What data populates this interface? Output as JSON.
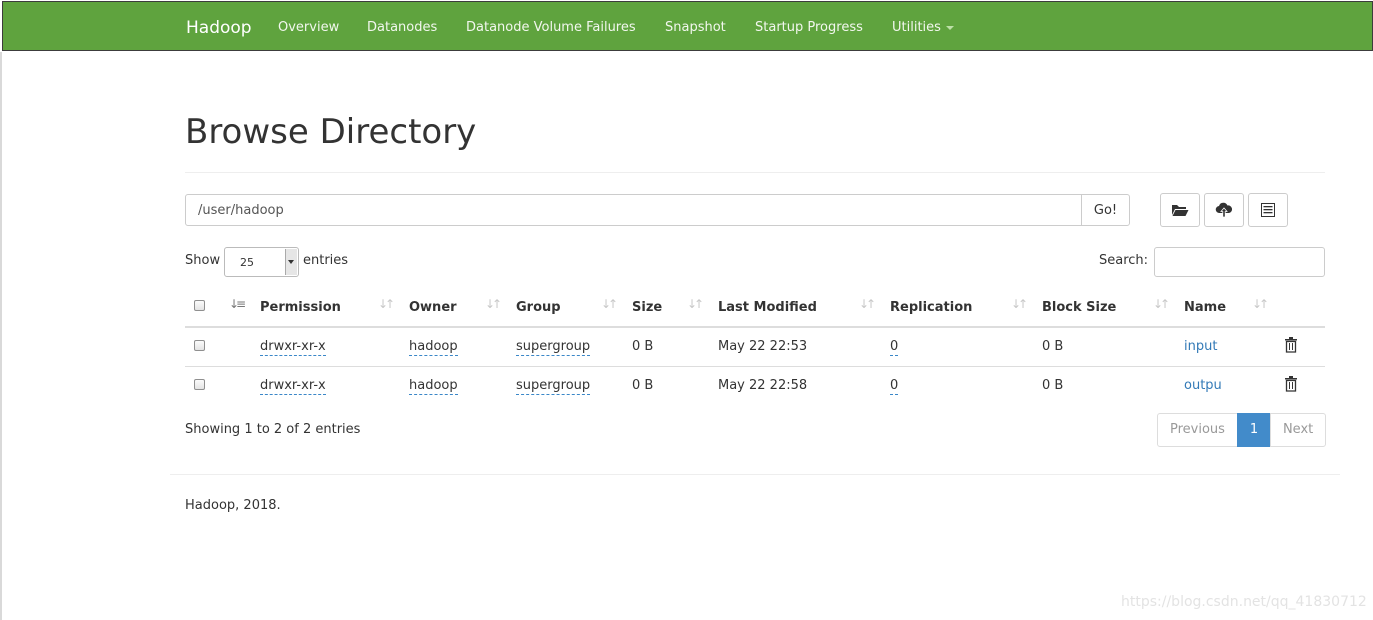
{
  "navbar": {
    "brand": "Hadoop",
    "items": [
      "Overview",
      "Datanodes",
      "Datanode Volume Failures",
      "Snapshot",
      "Startup Progress",
      "Utilities"
    ]
  },
  "page": {
    "title": "Browse Directory"
  },
  "path_bar": {
    "value": "/user/hadoop",
    "go_label": "Go!"
  },
  "toolbar": {
    "icons": [
      "folder-open-icon",
      "cloud-upload-icon",
      "list-icon"
    ]
  },
  "table_controls": {
    "show_label": "Show",
    "entries_value": "25",
    "entries_label": "entries",
    "search_label": "Search:"
  },
  "table": {
    "columns": [
      "Permission",
      "Owner",
      "Group",
      "Size",
      "Last Modified",
      "Replication",
      "Block Size",
      "Name"
    ],
    "rows": [
      {
        "permission": "drwxr-xr-x",
        "owner": "hadoop",
        "group": "supergroup",
        "size": "0 B",
        "modified": "May 22 22:53",
        "replication": "0",
        "block_size": "0 B",
        "name": "input"
      },
      {
        "permission": "drwxr-xr-x",
        "owner": "hadoop",
        "group": "supergroup",
        "size": "0 B",
        "modified": "May 22 22:58",
        "replication": "0",
        "block_size": "0 B",
        "name": "outpu"
      }
    ],
    "info": "Showing 1 to 2 of 2 entries"
  },
  "pagination": {
    "previous": "Previous",
    "current": "1",
    "next": "Next"
  },
  "footer": {
    "text": "Hadoop, 2018."
  },
  "watermark": "https://blog.csdn.net/qq_41830712",
  "colors": {
    "navbar": "#5fa33e",
    "link": "#337ab7",
    "active_page": "#428bca"
  }
}
